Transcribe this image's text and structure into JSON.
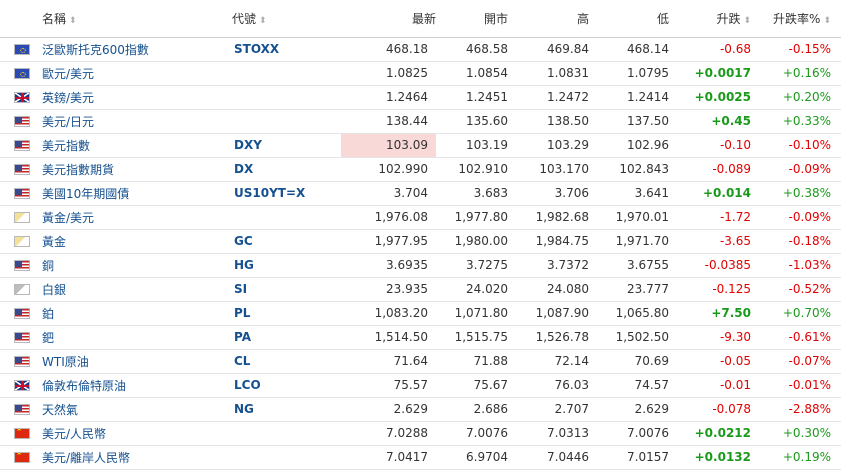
{
  "header": {
    "name": "名稱",
    "code": "代號",
    "last": "最新",
    "open": "開市",
    "high": "高",
    "low": "低",
    "change": "升跌",
    "change_pct": "升跌率%"
  },
  "rows": [
    {
      "flag": "eu-flag-icon",
      "name": "泛歐斯托克600指數",
      "code": "STOXX",
      "last": "468.18",
      "open": "468.58",
      "high": "469.84",
      "low": "468.14",
      "change": "-0.68",
      "change_pct": "-0.15%",
      "dir": "neg"
    },
    {
      "flag": "eu-flag-icon",
      "name": "歐元/美元",
      "code": "",
      "last": "1.0825",
      "open": "1.0854",
      "high": "1.0831",
      "low": "1.0795",
      "change": "+0.0017",
      "change_pct": "+0.16%",
      "dir": "pos"
    },
    {
      "flag": "gb-flag-icon",
      "name": "英鎊/美元",
      "code": "",
      "last": "1.2464",
      "open": "1.2451",
      "high": "1.2472",
      "low": "1.2414",
      "change": "+0.0025",
      "change_pct": "+0.20%",
      "dir": "pos"
    },
    {
      "flag": "us-flag-icon",
      "name": "美元/日元",
      "code": "",
      "last": "138.44",
      "open": "135.60",
      "high": "138.50",
      "low": "137.50",
      "change": "+0.45",
      "change_pct": "+0.33%",
      "dir": "pos"
    },
    {
      "flag": "us-flag-icon",
      "name": "美元指數",
      "code": "DXY",
      "last": "103.09",
      "open": "103.19",
      "high": "103.29",
      "low": "102.96",
      "change": "-0.10",
      "change_pct": "-0.10%",
      "dir": "neg",
      "highlight": true
    },
    {
      "flag": "us-flag-icon",
      "name": "美元指數期貨",
      "code": "DX",
      "last": "102.990",
      "open": "102.910",
      "high": "103.170",
      "low": "102.843",
      "change": "-0.089",
      "change_pct": "-0.09%",
      "dir": "neg"
    },
    {
      "flag": "us-flag-icon",
      "name": "美國10年期國債",
      "code": "US10YT=X",
      "last": "3.704",
      "open": "3.683",
      "high": "3.706",
      "low": "3.641",
      "change": "+0.014",
      "change_pct": "+0.38%",
      "dir": "pos"
    },
    {
      "flag": "gold-icon",
      "name": "黃金/美元",
      "code": "",
      "last": "1,976.08",
      "open": "1,977.80",
      "high": "1,982.68",
      "low": "1,970.01",
      "change": "-1.72",
      "change_pct": "-0.09%",
      "dir": "neg"
    },
    {
      "flag": "gold-icon",
      "name": "黃金",
      "code": "GC",
      "last": "1,977.95",
      "open": "1,980.00",
      "high": "1,984.75",
      "low": "1,971.70",
      "change": "-3.65",
      "change_pct": "-0.18%",
      "dir": "neg"
    },
    {
      "flag": "us-flag-icon",
      "name": "銅",
      "code": "HG",
      "last": "3.6935",
      "open": "3.7275",
      "high": "3.7372",
      "low": "3.6755",
      "change": "-0.0385",
      "change_pct": "-1.03%",
      "dir": "neg"
    },
    {
      "flag": "silver-icon",
      "name": "白銀",
      "code": "SI",
      "last": "23.935",
      "open": "24.020",
      "high": "24.080",
      "low": "23.777",
      "change": "-0.125",
      "change_pct": "-0.52%",
      "dir": "neg"
    },
    {
      "flag": "us-flag-icon",
      "name": "鉑",
      "code": "PL",
      "last": "1,083.20",
      "open": "1,071.80",
      "high": "1,087.90",
      "low": "1,065.80",
      "change": "+7.50",
      "change_pct": "+0.70%",
      "dir": "pos"
    },
    {
      "flag": "us-flag-icon",
      "name": "鈀",
      "code": "PA",
      "last": "1,514.50",
      "open": "1,515.75",
      "high": "1,526.78",
      "low": "1,502.50",
      "change": "-9.30",
      "change_pct": "-0.61%",
      "dir": "neg"
    },
    {
      "flag": "us-flag-icon",
      "name": "WTI原油",
      "code": "CL",
      "last": "71.64",
      "open": "71.88",
      "high": "72.14",
      "low": "70.69",
      "change": "-0.05",
      "change_pct": "-0.07%",
      "dir": "neg"
    },
    {
      "flag": "gb-flag-icon",
      "name": "倫敦布倫特原油",
      "code": "LCO",
      "last": "75.57",
      "open": "75.67",
      "high": "76.03",
      "low": "74.57",
      "change": "-0.01",
      "change_pct": "-0.01%",
      "dir": "neg"
    },
    {
      "flag": "us-flag-icon",
      "name": "天然氣",
      "code": "NG",
      "last": "2.629",
      "open": "2.686",
      "high": "2.707",
      "low": "2.629",
      "change": "-0.078",
      "change_pct": "-2.88%",
      "dir": "neg"
    },
    {
      "flag": "cn-flag-icon",
      "name": "美元/人民幣",
      "code": "",
      "last": "7.0288",
      "open": "7.0076",
      "high": "7.0313",
      "low": "7.0076",
      "change": "+0.0212",
      "change_pct": "+0.30%",
      "dir": "pos"
    },
    {
      "flag": "cn-flag-icon",
      "name": "美元/離岸人民幣",
      "code": "",
      "last": "7.0417",
      "open": "6.9704",
      "high": "7.0446",
      "low": "7.0157",
      "change": "+0.0132",
      "change_pct": "+0.19%",
      "dir": "pos"
    }
  ]
}
